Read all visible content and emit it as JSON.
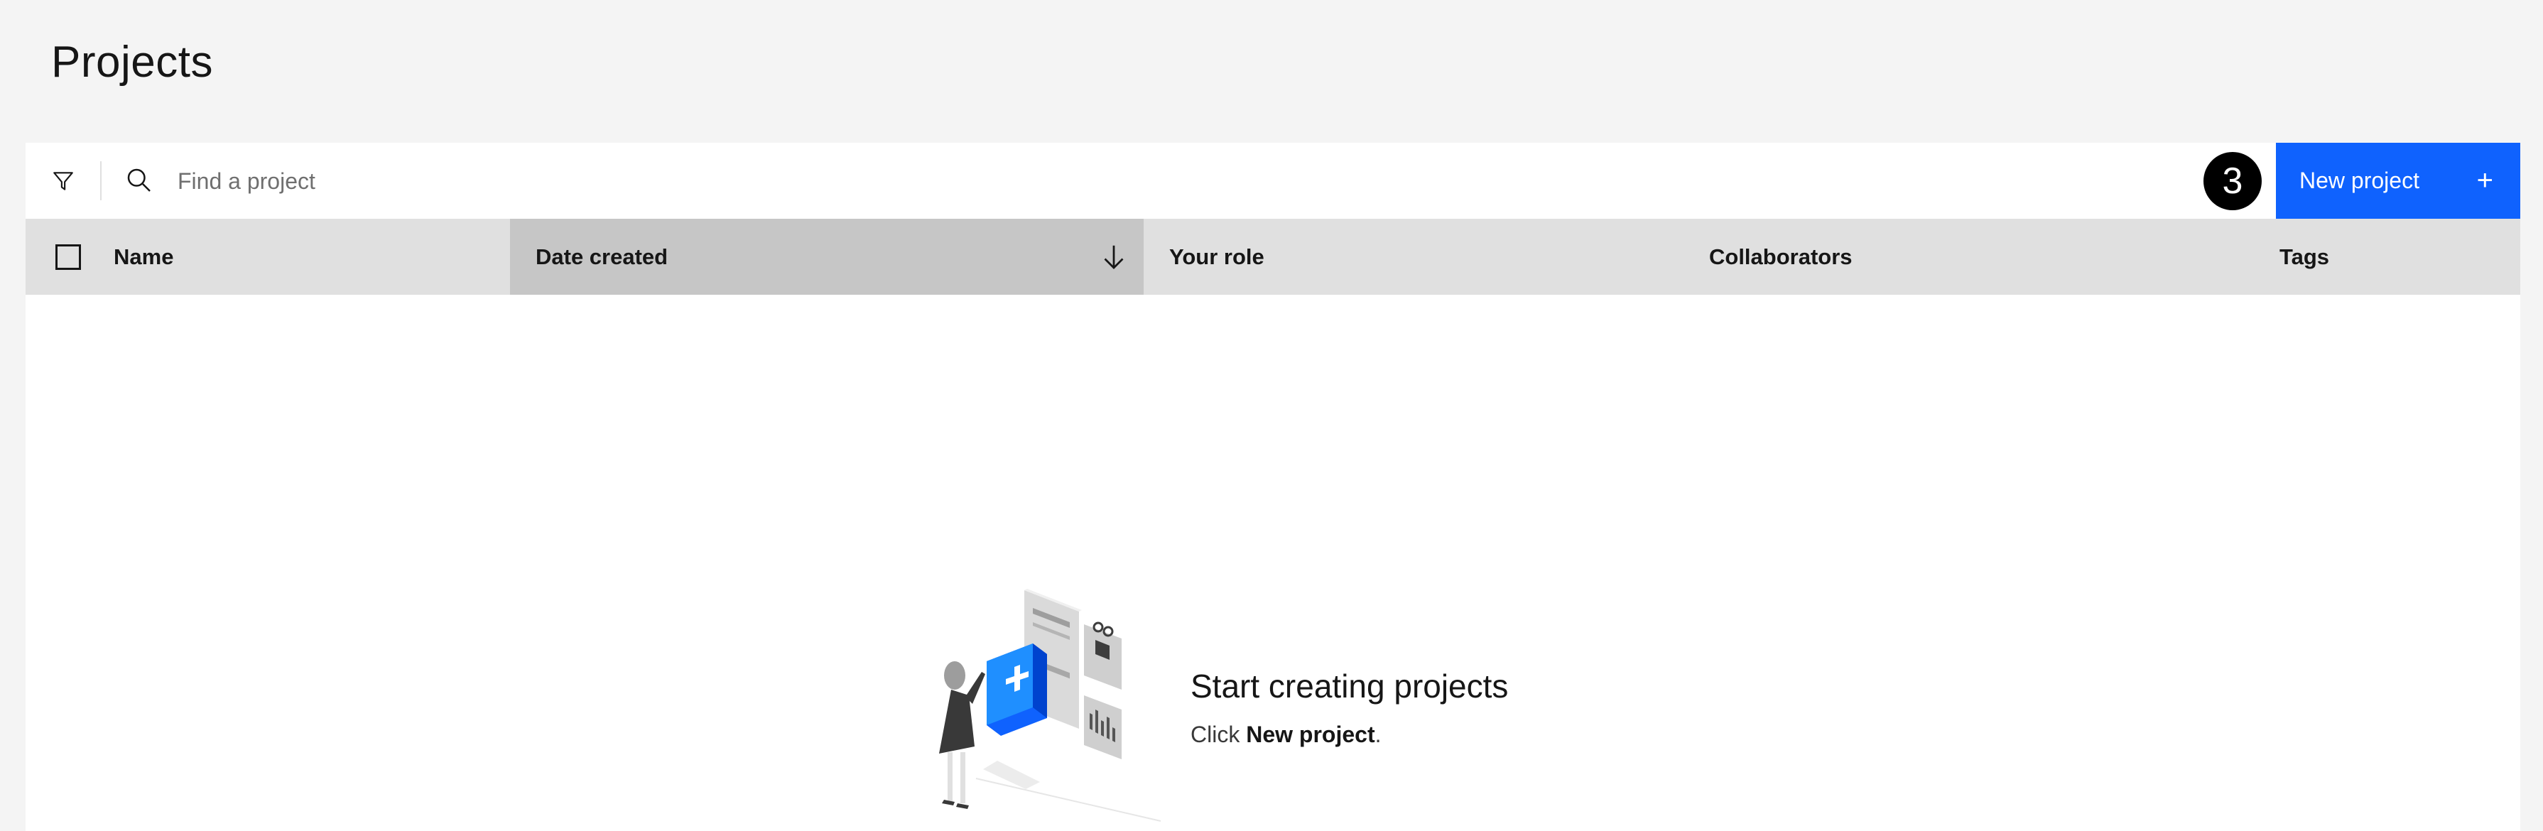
{
  "page": {
    "title": "Projects"
  },
  "toolbar": {
    "search_placeholder": "Find a project",
    "step_badge": "3",
    "new_project_label": "New project",
    "new_project_icon": "+"
  },
  "table": {
    "columns": [
      {
        "label": "Name"
      },
      {
        "label": "Date created",
        "sorted": "descending"
      },
      {
        "label": "Your role"
      },
      {
        "label": "Collaborators"
      },
      {
        "label": "Tags"
      }
    ]
  },
  "empty_state": {
    "title": "Start creating projects",
    "desc_prefix": "Click ",
    "desc_bold": "New project",
    "desc_suffix": "."
  },
  "colors": {
    "primary": "#0f62fe",
    "background": "#f4f4f4",
    "header_bg": "#e0e0e0",
    "sorted_header_bg": "#c6c6c6",
    "illustration_blue": "#1f8fff"
  }
}
